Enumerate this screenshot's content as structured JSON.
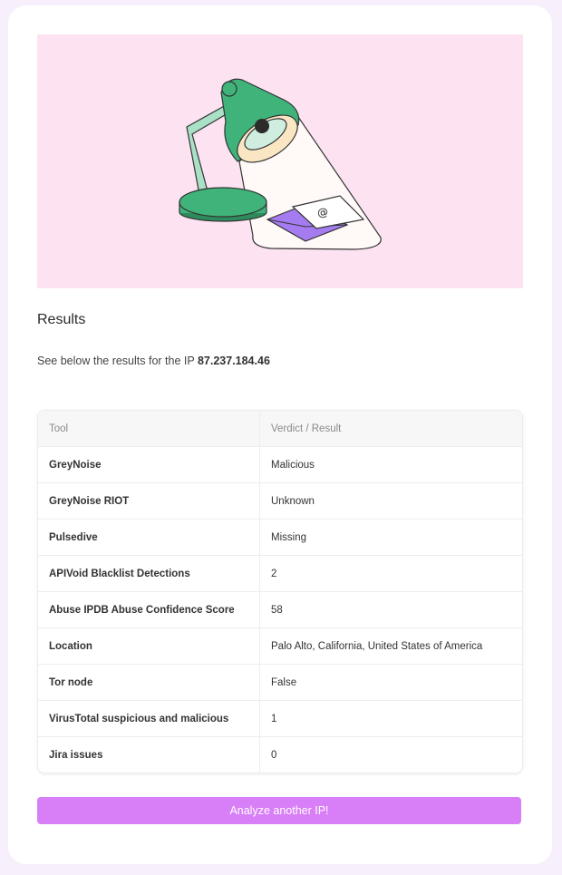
{
  "results": {
    "title": "Results",
    "intro_text": "See below the results for the IP ",
    "ip": "87.237.184.46"
  },
  "table": {
    "headers": [
      "Tool",
      "Verdict / Result"
    ],
    "rows": [
      {
        "tool": "GreyNoise",
        "verdict": "Malicious"
      },
      {
        "tool": "GreyNoise RIOT",
        "verdict": "Unknown"
      },
      {
        "tool": "Pulsedive",
        "verdict": "Missing"
      },
      {
        "tool": "APIVoid Blacklist Detections",
        "verdict": "2"
      },
      {
        "tool": "Abuse IPDB Abuse Confidence Score",
        "verdict": "58"
      },
      {
        "tool": "Location",
        "verdict": "Palo Alto, California, United States of America"
      },
      {
        "tool": "Tor node",
        "verdict": "False"
      },
      {
        "tool": "VirusTotal suspicious and malicious",
        "verdict": "1"
      },
      {
        "tool": "Jira issues",
        "verdict": "0"
      }
    ]
  },
  "actions": {
    "analyze_label": "Analyze another IP!"
  },
  "colors": {
    "page_bg": "#f7f0fc",
    "hero_bg": "#fde3f2",
    "accent": "#d87ef6",
    "lamp_green": "#3fb37a"
  }
}
